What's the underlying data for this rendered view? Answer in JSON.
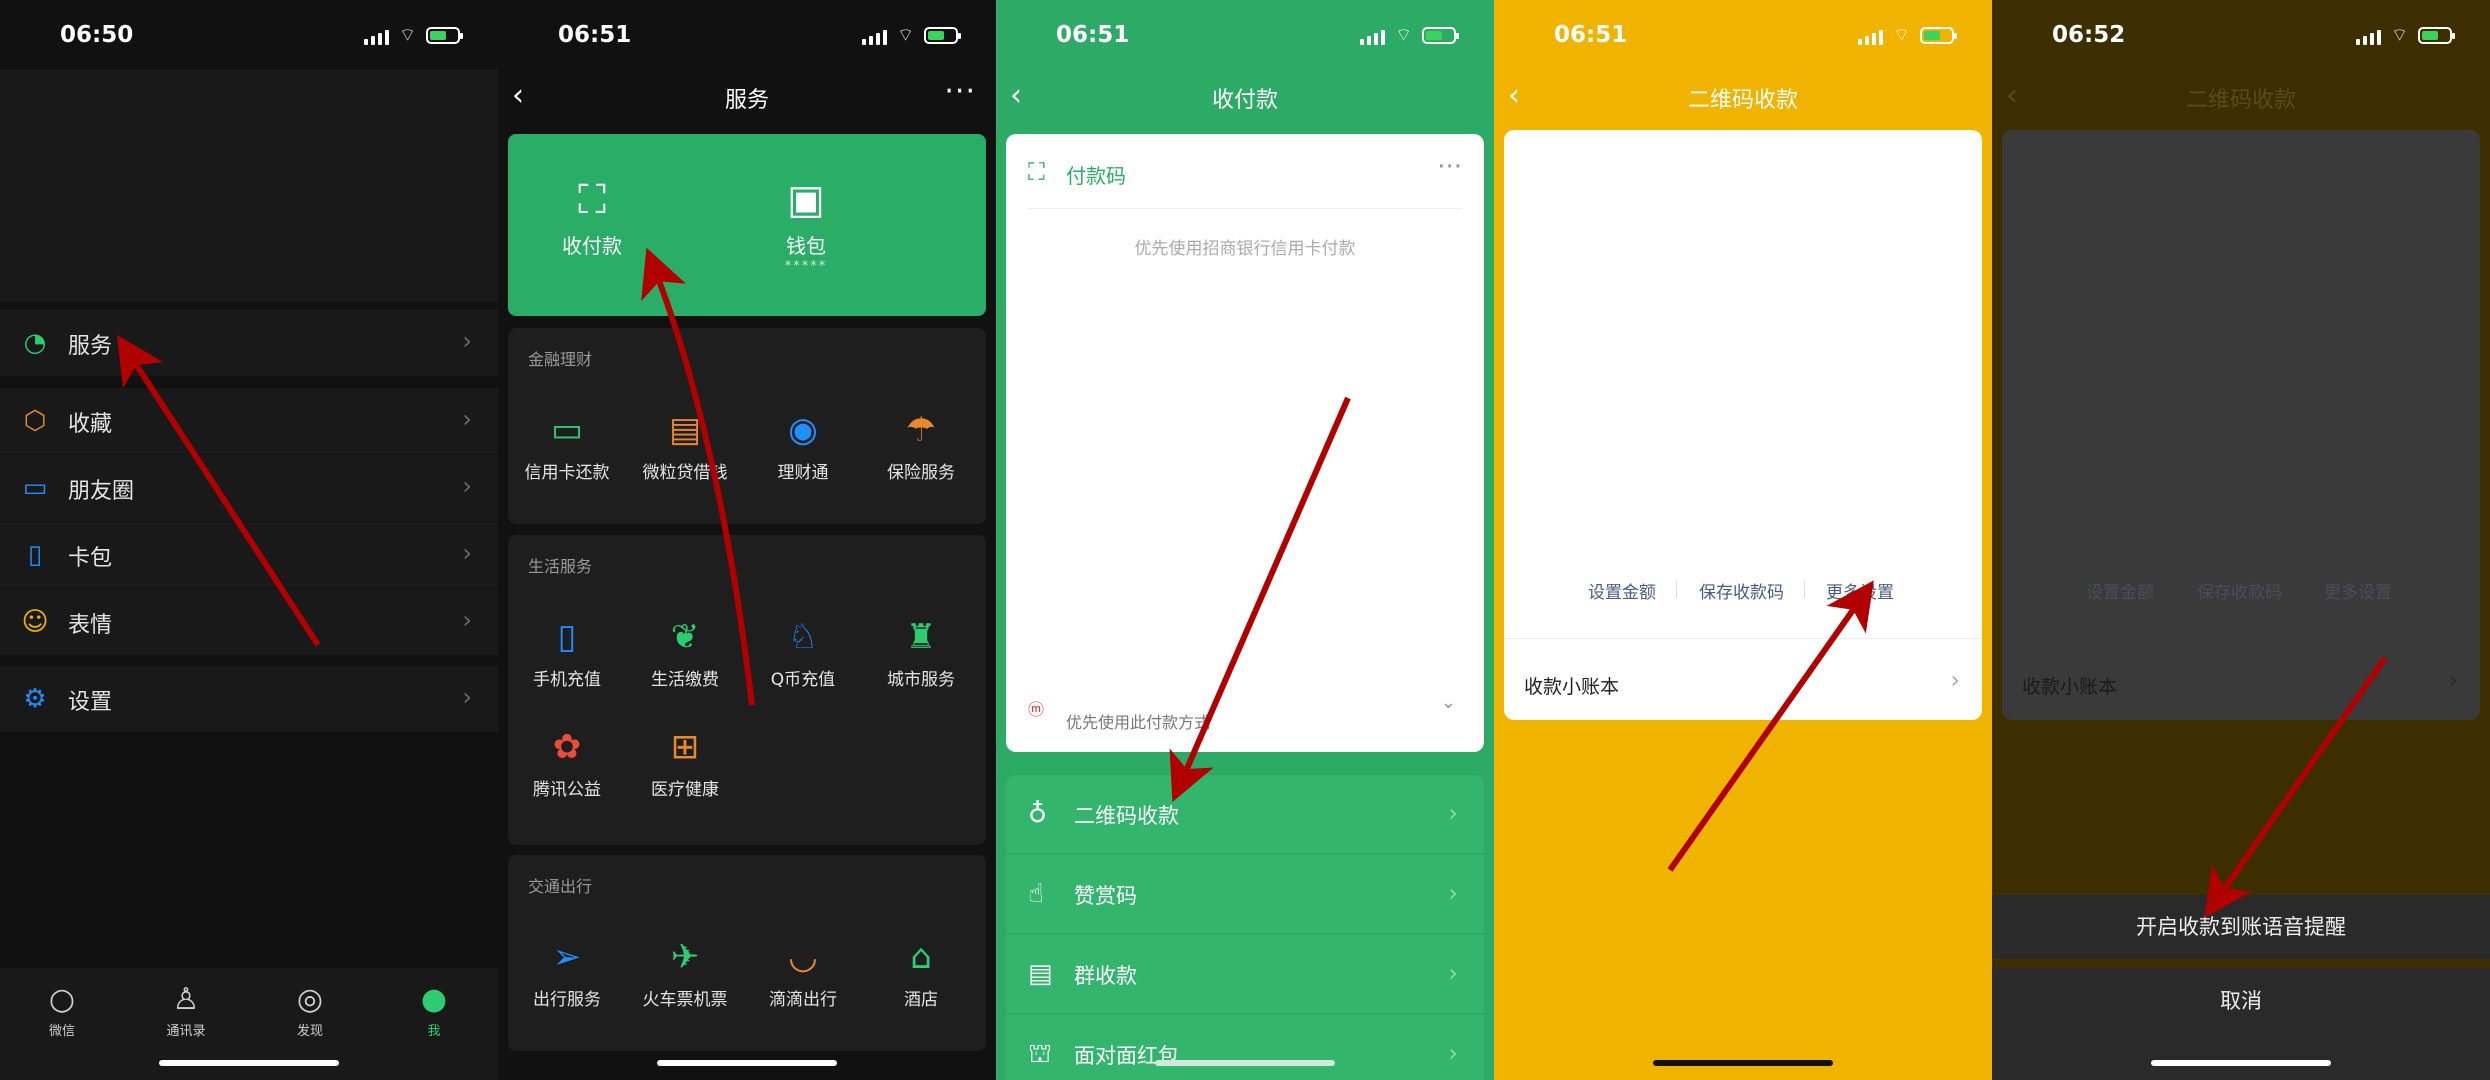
{
  "colors": {
    "wechat_green": "#2aae67",
    "yellow": "#f0b400",
    "dark_bg": "#111111",
    "arrow": "#b00000"
  },
  "panel1": {
    "time": "06:50",
    "menu": [
      {
        "label": "服务",
        "icon": "service-icon"
      },
      {
        "label": "收藏",
        "icon": "favorites-cube-icon"
      },
      {
        "label": "朋友圈",
        "icon": "moments-picture-icon"
      },
      {
        "label": "卡包",
        "icon": "card-wallet-icon"
      },
      {
        "label": "表情",
        "icon": "emoji-smile-icon"
      },
      {
        "label": "设置",
        "icon": "gear-icon"
      }
    ],
    "tabs": [
      {
        "label": "微信",
        "icon": "chat-bubble-icon"
      },
      {
        "label": "通讯录",
        "icon": "contacts-icon"
      },
      {
        "label": "发现",
        "icon": "compass-icon"
      },
      {
        "label": "我",
        "icon": "person-icon"
      }
    ]
  },
  "panel2": {
    "time": "06:51",
    "title": "服务",
    "green_card": {
      "pay": {
        "label": "收付款",
        "icon": "scan-check-icon"
      },
      "wallet": {
        "label": "钱包",
        "sub": "*****",
        "icon": "wallet-icon"
      }
    },
    "sections": [
      {
        "title": "金融理财",
        "items": [
          {
            "label": "信用卡还款",
            "icon": "credit-card-icon",
            "color": "#2ecc71"
          },
          {
            "label": "微粒贷借钱",
            "icon": "loan-icon",
            "color": "#e6892f"
          },
          {
            "label": "理财通",
            "icon": "wealth-icon",
            "color": "#1e90ff"
          },
          {
            "label": "保险服务",
            "icon": "insurance-icon",
            "color": "#e6892f"
          }
        ]
      },
      {
        "title": "生活服务",
        "items": [
          {
            "label": "手机充值",
            "icon": "phone-icon",
            "color": "#1e90ff"
          },
          {
            "label": "生活缴费",
            "icon": "utility-leaf-icon",
            "color": "#2ecc71"
          },
          {
            "label": "Q币充值",
            "icon": "qq-penguin-icon",
            "color": "#1e90ff"
          },
          {
            "label": "城市服务",
            "icon": "city-service-icon",
            "color": "#2ecc71"
          },
          {
            "label": "腾讯公益",
            "icon": "charity-flower-icon",
            "color": "#e74c3c"
          },
          {
            "label": "医疗健康",
            "icon": "medical-cross-icon",
            "color": "#e6892f"
          }
        ]
      },
      {
        "title": "交通出行",
        "items": [
          {
            "label": "出行服务",
            "icon": "navigation-icon",
            "color": "#1e90ff"
          },
          {
            "label": "火车票机票",
            "icon": "train-plane-icon",
            "color": "#2ecc71"
          },
          {
            "label": "滴滴出行",
            "icon": "didi-icon",
            "color": "#e6892f"
          },
          {
            "label": "酒店",
            "icon": "hotel-bed-icon",
            "color": "#2ecc71"
          }
        ]
      }
    ]
  },
  "panel3": {
    "time": "06:51",
    "title": "收付款",
    "card_title": "付款码",
    "hint": "优先使用招商银行信用卡付款",
    "pay_method": "优先使用此付款方式",
    "rows": [
      {
        "label": "二维码收款",
        "icon": "money-bag-icon"
      },
      {
        "label": "赞赏码",
        "icon": "thumbs-up-icon"
      },
      {
        "label": "群收款",
        "icon": "group-bill-icon"
      },
      {
        "label": "面对面红包",
        "icon": "red-packet-icon"
      }
    ]
  },
  "panel4": {
    "time": "06:51",
    "title": "二维码收款",
    "actions": [
      "设置金额",
      "保存收款码",
      "更多设置"
    ],
    "ledger": "收款小账本"
  },
  "panel5": {
    "time": "06:52",
    "title": "二维码收款",
    "actions": [
      "设置金额",
      "保存收款码",
      "更多设置"
    ],
    "ledger": "收款小账本",
    "sheet_option": "开启收款到账语音提醒",
    "cancel": "取消"
  }
}
